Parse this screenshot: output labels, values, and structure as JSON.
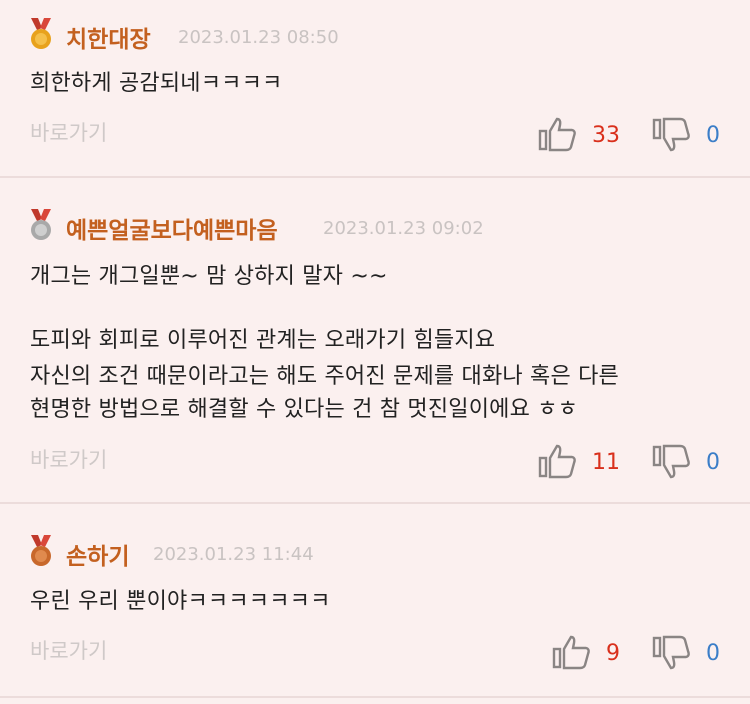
{
  "comments": [
    {
      "medal": "gold",
      "nickname": "치한대장",
      "timestamp": "2023.01.23 08:50",
      "lines": [
        "희한하게 공감되네ㅋㅋㅋㅋ"
      ],
      "goto_label": "바로가기",
      "likes": "33",
      "dislikes": "0"
    },
    {
      "medal": "silver",
      "nickname": "예쁜얼굴보다예쁜마음",
      "timestamp": "2023.01.23 09:02",
      "lines": [
        "개그는 개그일뿐~ 맘 상하지 말자 ~~",
        "",
        "도피와 회피로 이루어진 관계는 오래가기 힘들지요",
        "자신의 조건 때문이라고는 해도 주어진 문제를 대화나 혹은 다른",
        "현명한 방법으로 해결할 수 있다는 건 참 멋진일이에요 ㅎㅎ"
      ],
      "goto_label": "바로가기",
      "likes": "11",
      "dislikes": "0"
    },
    {
      "medal": "bronze",
      "nickname": "손하기",
      "timestamp": "2023.01.23 11:44",
      "lines": [
        "우린 우리 뿐이야ㅋㅋㅋㅋㅋㅋㅋ"
      ],
      "goto_label": "바로가기",
      "likes": "9",
      "dislikes": "0"
    }
  ],
  "colors": {
    "background": "#fbf0ef",
    "nickname": "#c3601f",
    "like_count": "#d9301c",
    "dislike_count": "#3b7ec8",
    "gold": "#e8a21c",
    "silver": "#a9a9a9",
    "bronze": "#c8682b",
    "ribbon": "#c0392b"
  },
  "icons": {
    "medal": "medal-icon",
    "like": "thumbs-up-icon",
    "dislike": "thumbs-down-icon"
  }
}
